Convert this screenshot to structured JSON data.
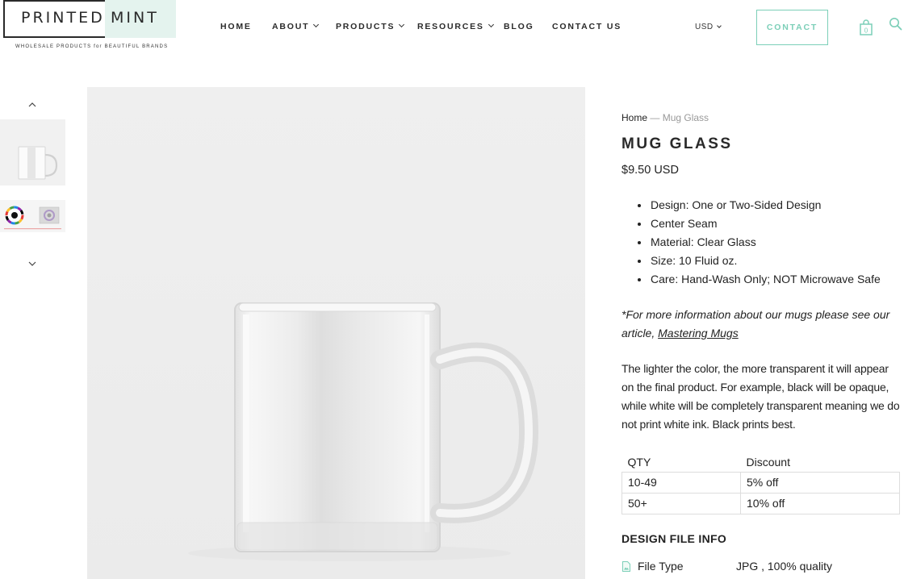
{
  "logo": {
    "part1": "PRINTED",
    "part2": "MINT",
    "tagline": "WHOLESALE PRODUCTS for BEAUTIFUL BRANDS"
  },
  "nav": {
    "items": [
      {
        "label": "HOME",
        "dropdown": false
      },
      {
        "label": "ABOUT",
        "dropdown": true
      },
      {
        "label": "PRODUCTS",
        "dropdown": true
      },
      {
        "label": "RESOURCES",
        "dropdown": true
      },
      {
        "label": "BLOG",
        "dropdown": false
      },
      {
        "label": "CONTACT US",
        "dropdown": false
      }
    ],
    "currency": "USD",
    "contact_button": "CONTACT",
    "cart_count": "0",
    "accent": "#7ccfb8"
  },
  "breadcrumb": {
    "home": "Home",
    "separator": "—",
    "current": "Mug Glass"
  },
  "product": {
    "title": "MUG GLASS",
    "price": "$9.50 USD",
    "features": [
      "Design: One or Two-Sided Design",
      "Center Seam",
      "Material: Clear Glass",
      "Size: 10 Fluid oz.",
      "Care: Hand-Wash Only; NOT Microwave Safe"
    ],
    "note_prefix": "*For more information about our mugs please see our article, ",
    "note_link": "Mastering Mugs",
    "description": "The lighter the color, the more transparent it will appear on the final product. For example, black will be opaque, while white will be completely transparent meaning we do not print white ink. Black prints best."
  },
  "discount_table": {
    "headers": [
      "QTY",
      "Discount"
    ],
    "rows": [
      [
        "10-49",
        "5% off"
      ],
      [
        "50+",
        "10% off"
      ]
    ]
  },
  "design_file": {
    "heading": "DESIGN FILE INFO",
    "label": "File Type",
    "value": "JPG , 100% quality"
  }
}
